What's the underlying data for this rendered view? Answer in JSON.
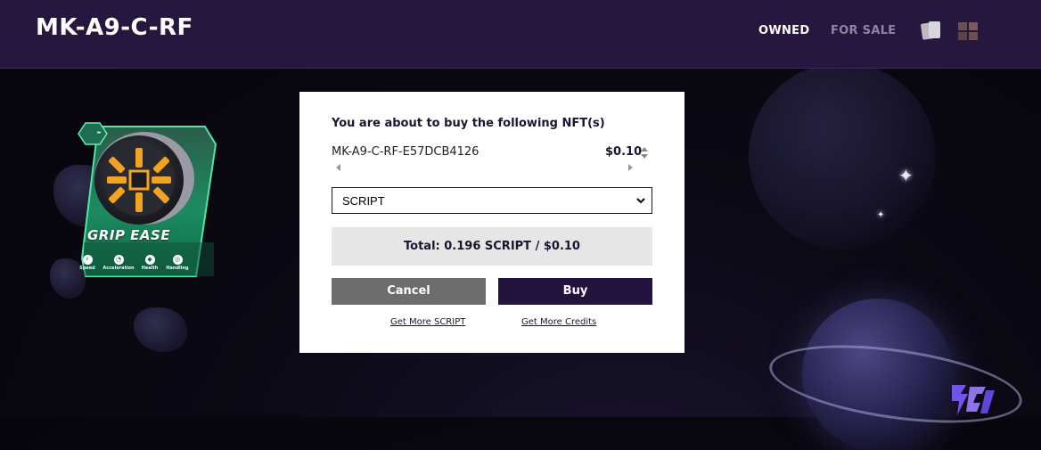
{
  "header": {
    "title": "MK-A9-C-RF",
    "nav": {
      "owned": "OWNED",
      "for_sale": "FOR SALE"
    },
    "icons": [
      "cards-view-icon",
      "grid-view-icon"
    ]
  },
  "card": {
    "name": "GRIP EASE",
    "badge": "-",
    "stats": [
      {
        "label": "Speed",
        "icon": "lightning-icon"
      },
      {
        "label": "Acceleration",
        "icon": "gauge-icon"
      },
      {
        "label": "Health",
        "icon": "shield-icon"
      },
      {
        "label": "Handling",
        "icon": "steering-wheel-icon"
      }
    ],
    "accent_color": "#2fc98a"
  },
  "modal": {
    "heading": "You are about to buy the following NFT(s)",
    "nft_id": "MK-A9-C-RF-E57DCB4126",
    "price": "$0.10",
    "currency_selected": "SCRIPT",
    "total": "Total: 0.196 SCRIPT / $0.10",
    "cancel_label": "Cancel",
    "buy_label": "Buy",
    "get_script_label": "Get More SCRIPT",
    "get_credits_label": "Get More Credits"
  },
  "colors": {
    "header_bg": "#26173f",
    "buy_button": "#22143f",
    "cancel_button": "#6d6d6d"
  }
}
